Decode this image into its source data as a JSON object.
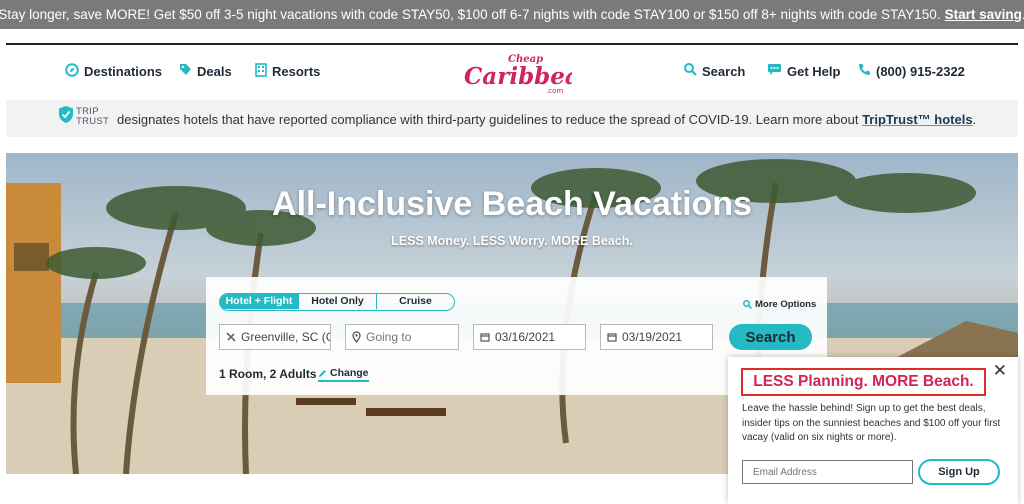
{
  "promo": {
    "text": "Stay longer, save MORE! Get $50 off 3-5 night vacations with code STAY50, $100 off 6-7 nights with code STAY100 or $150 off 8+ nights with code STAY150.",
    "cta": "Start saving",
    "trailing": "."
  },
  "nav": {
    "left": [
      {
        "label": "Destinations",
        "icon": "compass-icon"
      },
      {
        "label": "Deals",
        "icon": "tag-icon"
      },
      {
        "label": "Resorts",
        "icon": "building-icon"
      }
    ],
    "right": [
      {
        "label": "Search",
        "icon": "search-icon"
      },
      {
        "label": "Get Help",
        "icon": "chat-icon"
      },
      {
        "label": "(800) 915-2322",
        "icon": "phone-icon"
      }
    ]
  },
  "logo": {
    "top": "Cheap",
    "main": "Caribbean",
    "suffix": ".com"
  },
  "triptrust": {
    "logo_line1": "TRIP",
    "logo_line2": "TRUST",
    "text": "designates hotels that have reported compliance with third-party guidelines to reduce the spread of COVID-19. Learn more about",
    "link": "TripTrust™ hotels",
    "trailing": "."
  },
  "hero": {
    "title": "All-Inclusive Beach Vacations",
    "subtitle": "LESS Money. LESS Worry. MORE Beach."
  },
  "search": {
    "tabs": [
      {
        "label": "Hotel + Flight",
        "active": true
      },
      {
        "label": "Hotel Only",
        "active": false
      },
      {
        "label": "Cruise",
        "active": false
      }
    ],
    "more_options": "More Options",
    "origin": "Greenville, SC (GSP)",
    "destination_placeholder": "Going to",
    "check_in": "03/16/2021",
    "check_out": "03/19/2021",
    "button": "Search",
    "occupancy": "1 Room, 2 Adults",
    "change": "Change"
  },
  "popup": {
    "close": "✕",
    "headline": "LESS Planning. MORE Beach.",
    "body": "Leave the hassle behind! Sign up to get the best deals, insider tips on the sunniest beaches and $100 off your first vacay (valid on six nights or more).",
    "email_placeholder": "Email Address",
    "button": "Sign Up"
  },
  "colors": {
    "accent": "#24b9c3",
    "brand_pink": "#d2245a",
    "promo_bg": "#7a7a7a",
    "highlight_border": "#e02b2b"
  }
}
